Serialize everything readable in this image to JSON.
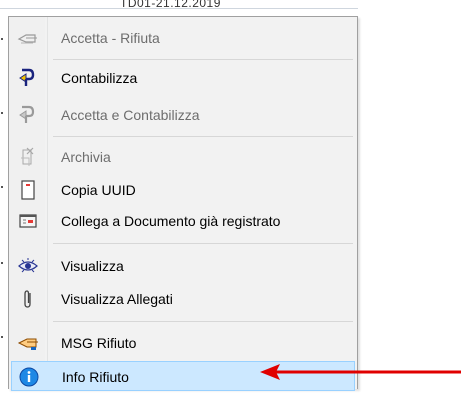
{
  "background_text": "TD01-21.12.2019",
  "menu": {
    "items": [
      {
        "label": "Accetta - Rifiuta",
        "icon": "hand-pointing-left-outline-icon",
        "enabled": false
      },
      {
        "label": "Contabilizza",
        "icon": "ledger-arrow-icon",
        "enabled": true
      },
      {
        "label": "Accetta e Contabilizza",
        "icon": "ledger-arrow-icon",
        "enabled": false
      },
      {
        "label": "Archivia",
        "icon": "archive-icon",
        "enabled": false
      },
      {
        "label": "Copia UUID",
        "icon": "red-document-icon",
        "enabled": true
      },
      {
        "label": "Collega a Documento già registrato",
        "icon": "link-document-icon",
        "enabled": true
      },
      {
        "label": "Visualizza",
        "icon": "eye-icon",
        "enabled": true
      },
      {
        "label": "Visualizza Allegati",
        "icon": "paperclip-icon",
        "enabled": true
      },
      {
        "label": "MSG Rifiuto",
        "icon": "hand-pointing-left-icon",
        "enabled": true
      },
      {
        "label": "Info Rifiuto",
        "icon": "info-icon",
        "enabled": true,
        "highlighted": true
      }
    ]
  },
  "colors": {
    "highlight": "#cce8ff",
    "arrow": "#e00000",
    "disabled_text": "#6d6d6d"
  }
}
